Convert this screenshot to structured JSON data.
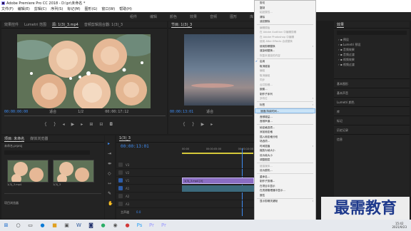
{
  "window": {
    "title": "Adobe Premiere Pro CC 2018 - D:\\pr\\未命名 *"
  },
  "menu": [
    "文件(F)",
    "编辑(E)",
    "剪辑(C)",
    "序列(S)",
    "标记(M)",
    "图形(G)",
    "窗口(W)",
    "帮助(H)"
  ],
  "workspaces": [
    "组件",
    "编辑",
    "颜色",
    "效果",
    "音频",
    "图形",
    "库"
  ],
  "source_panel": {
    "tabs": [
      "效果控件",
      "Lumetri 范围",
      "源: 1(3)_3.mp4",
      "音频剪辑混合器: 1(3)_3"
    ],
    "timecode": "00:00:00:00",
    "fit": "适合",
    "ratio": "1/2",
    "duration": "00:00:17:12"
  },
  "program_panel": {
    "tabs": [
      "节目: 1(3)_3"
    ],
    "timecode": "00:00:13:01",
    "fit": "适合",
    "ratio": "1/2",
    "duration": "00:00:17:12"
  },
  "project_panel": {
    "tabs": [
      "项目: 未命名",
      "媒体浏览器"
    ],
    "file": "未命名.prproj",
    "clips": [
      {
        "name": "1(3)_3.mp4",
        "dur": "17:12"
      },
      {
        "name": "1(3)_3",
        "dur": "17:12"
      }
    ],
    "footer": "项目浏览器"
  },
  "timeline": {
    "tabs": [
      "1(3)_3"
    ],
    "timecode": "00:00:13:01",
    "ruler": [
      "00:00",
      "00:00:05:00",
      "00:00:10:00"
    ],
    "clip_label": "1(3)_3.mp4 [V]",
    "tracks": [
      "V3",
      "V2",
      "V1",
      "A1",
      "A2",
      "A3"
    ],
    "master": "主声道",
    "master_val": "0.0"
  },
  "context_menu": {
    "items": [
      {
        "label": "剪切",
        "dis": false
      },
      {
        "label": "复制",
        "dis": false
      },
      {
        "label": "粘贴属性...",
        "dis": true
      },
      {
        "label": "清除",
        "dis": false
      },
      {
        "label": "波纹删除",
        "dis": false
      },
      {
        "sep": true
      },
      {
        "label": "编辑原始",
        "dis": true
      },
      {
        "label": "在 Adobe Audition 中编辑剪辑",
        "dis": true
      },
      {
        "label": "在 Adobe Photoshop 中编辑",
        "dis": true
      },
      {
        "label": "使用 After Effects 合成替换",
        "dis": true
      },
      {
        "label": "使用剪辑替换",
        "dis": false,
        "arrow": true
      },
      {
        "label": "渲染和替换...",
        "dis": false
      },
      {
        "label": "恢复未渲染的内容",
        "dis": true
      },
      {
        "sep": true
      },
      {
        "label": "启用",
        "dis": false,
        "check": true
      },
      {
        "label": "取消链接",
        "dis": false
      },
      {
        "label": "编组",
        "dis": true
      },
      {
        "label": "取消编组",
        "dis": true
      },
      {
        "label": "同步",
        "dis": true
      },
      {
        "label": "合并剪辑...",
        "dis": true
      },
      {
        "label": "嵌套...",
        "dis": false
      },
      {
        "label": "制作子序列",
        "dis": false
      },
      {
        "label": "多机位",
        "dis": true,
        "arrow": true
      },
      {
        "sep": true
      },
      {
        "label": "标签",
        "dis": false,
        "arrow": true
      },
      {
        "sep": true
      },
      {
        "label": "速度/持续时间...",
        "dis": false,
        "hl": true
      },
      {
        "sep": true
      },
      {
        "label": "音频增益...",
        "dis": false
      },
      {
        "label": "音频声道...",
        "dis": false
      },
      {
        "sep": true
      },
      {
        "label": "帧定格选项...",
        "dis": false
      },
      {
        "label": "添加帧定格",
        "dis": false
      },
      {
        "label": "插入帧定格分段",
        "dis": false
      },
      {
        "label": "场选项...",
        "dis": false
      },
      {
        "label": "时间插值",
        "dis": false,
        "arrow": true
      },
      {
        "label": "缩放为帧大小",
        "dis": false
      },
      {
        "label": "设为帧大小",
        "dis": false
      },
      {
        "label": "调整图层",
        "dis": false
      },
      {
        "sep": true
      },
      {
        "label": "链接媒体...",
        "dis": true
      },
      {
        "label": "设为脱机...",
        "dis": false
      },
      {
        "sep": true
      },
      {
        "label": "重命名...",
        "dis": false
      },
      {
        "label": "制作子剪辑...",
        "dis": false
      },
      {
        "label": "在项目中显示",
        "dis": false
      },
      {
        "label": "在资源管理器中显示...",
        "dis": false
      },
      {
        "label": "属性",
        "dis": false
      },
      {
        "sep": true
      },
      {
        "label": "显示剪辑关键帧",
        "dis": false,
        "arrow": true
      }
    ]
  },
  "effects_panel": {
    "title": "效果",
    "tree": [
      "预设",
      "Lumetri 预设",
      "音频效果",
      "音频过渡",
      "视频效果",
      "视频过渡"
    ],
    "sections": [
      "基本图形",
      "基本声音",
      "Lumetri 颜色",
      "库",
      "标记",
      "历史记录",
      "信息"
    ]
  },
  "watermark": "最需教育",
  "clock": {
    "time": "15:42",
    "date": "2021/9/23"
  },
  "colors": {
    "accent": "#3f8cf2",
    "highlight": "#c9e3f7"
  }
}
